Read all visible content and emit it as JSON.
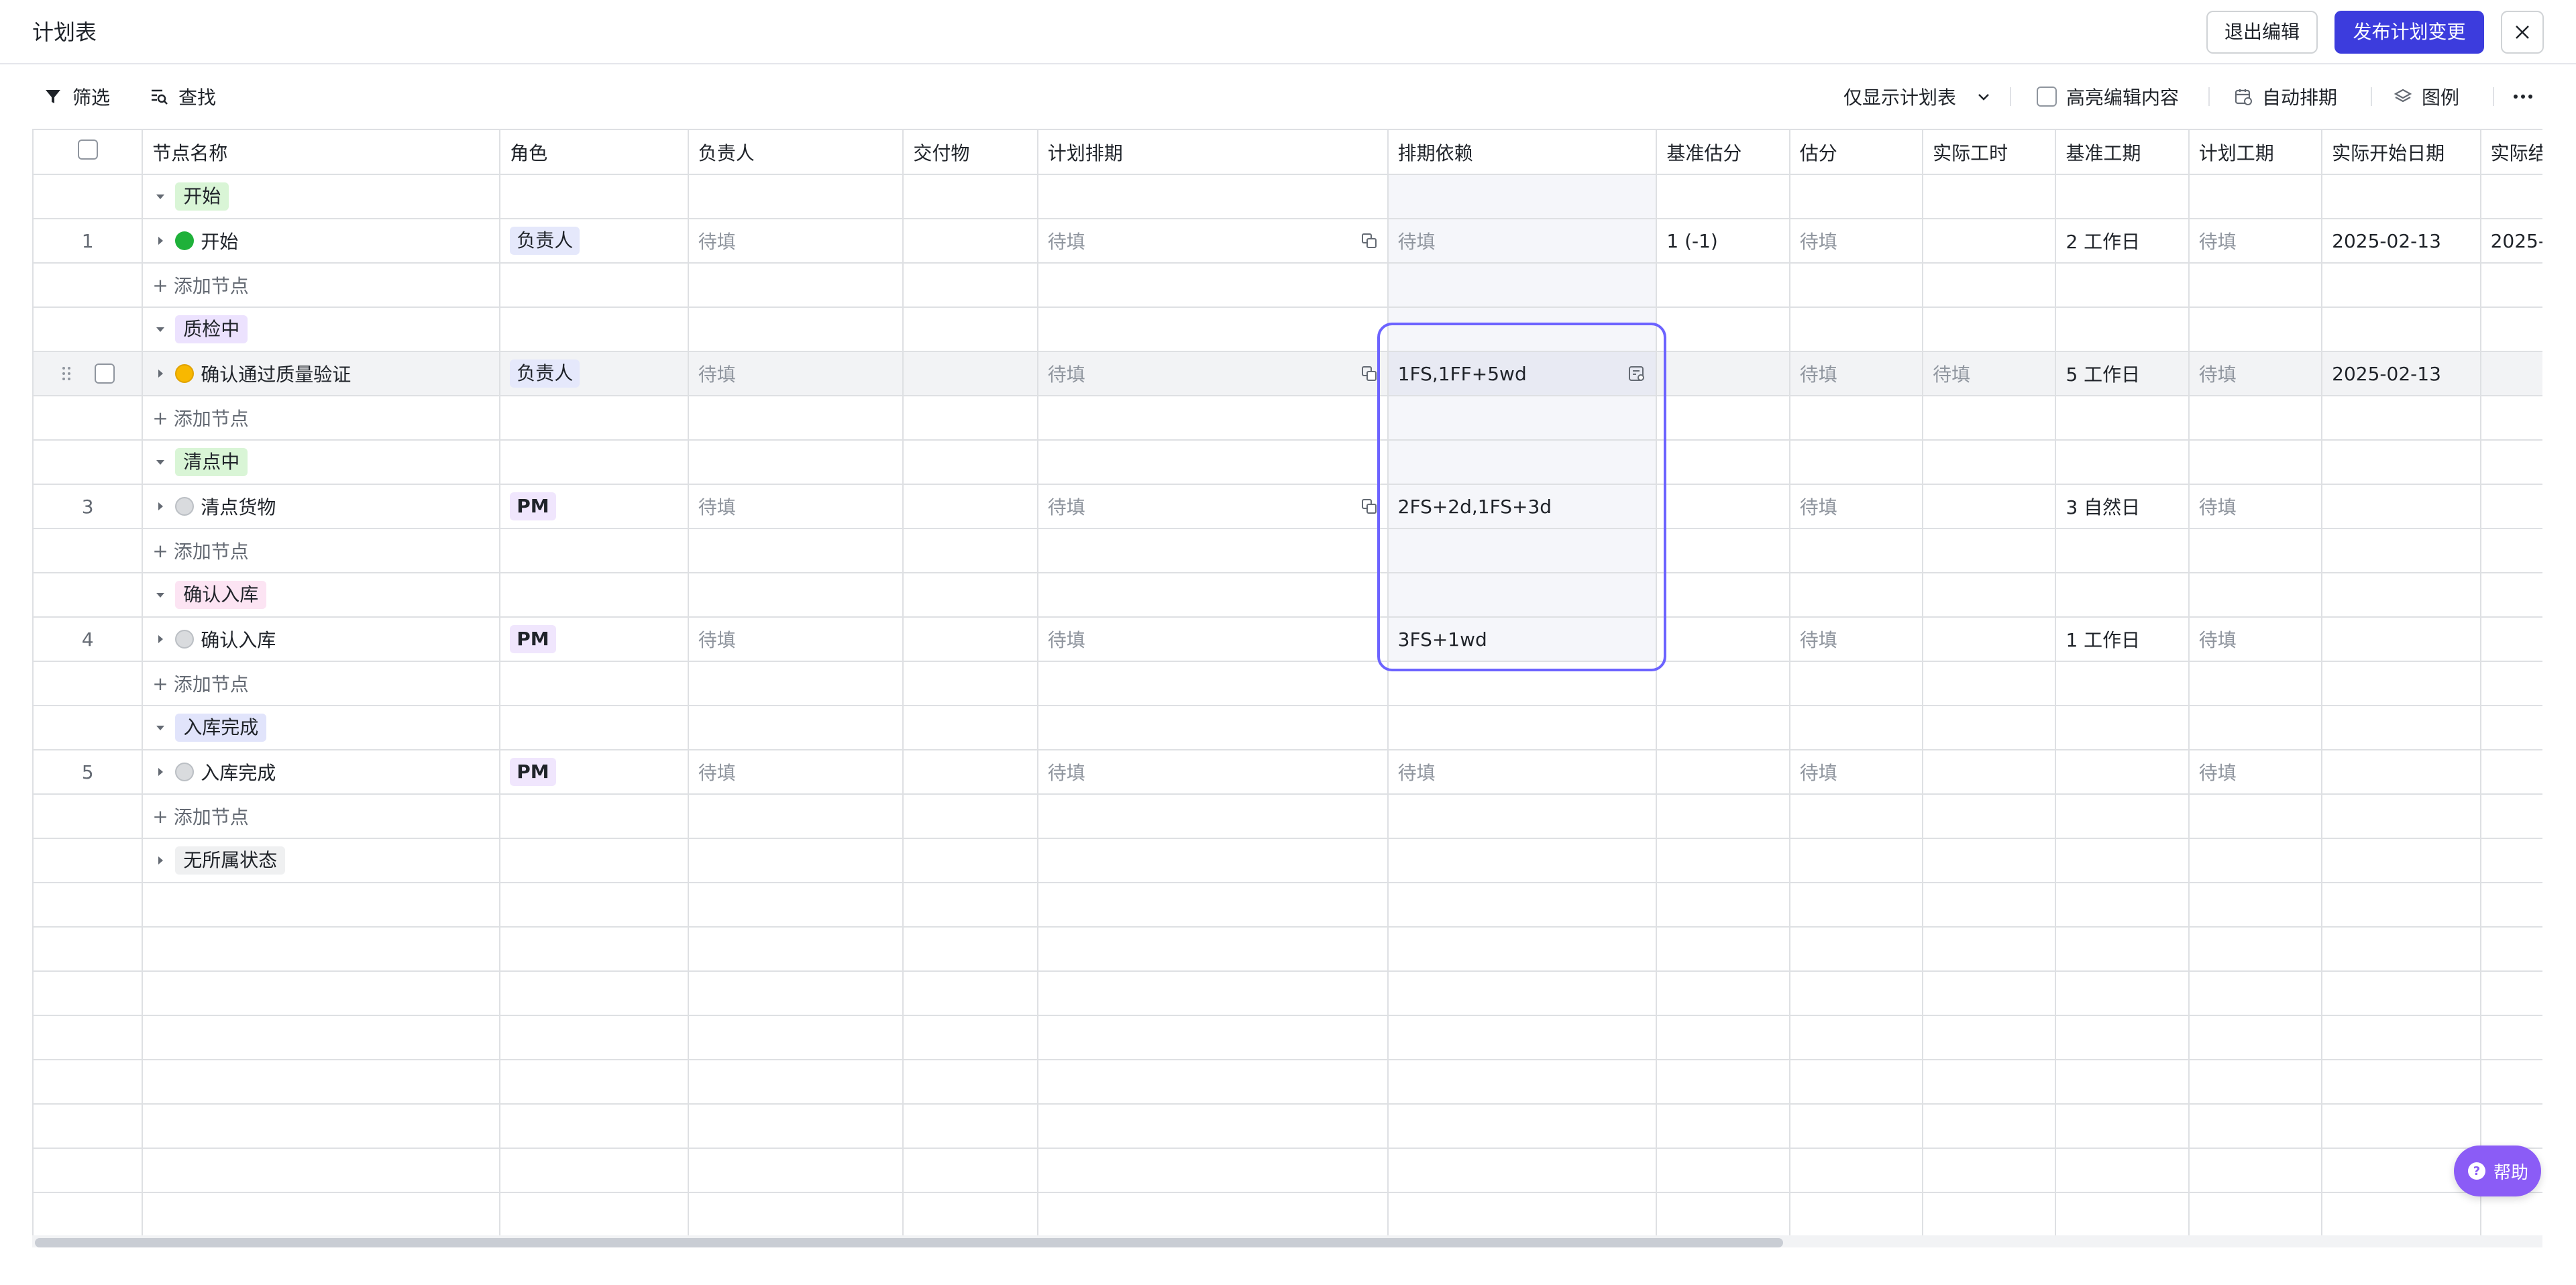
{
  "header": {
    "title": "计划表",
    "exit_label": "退出编辑",
    "publish_label": "发布计划变更"
  },
  "toolbar": {
    "filter_label": "筛选",
    "find_label": "查找",
    "view_select": "仅显示计划表",
    "highlight_label": "高亮编辑内容",
    "auto_schedule_label": "自动排期",
    "legend_label": "图例"
  },
  "columns": [
    "节点名称",
    "角色",
    "负责人",
    "交付物",
    "计划排期",
    "排期依赖",
    "基准估分",
    "估分",
    "实际工时",
    "基准工期",
    "计划工期",
    "实际开始日期",
    "实际结"
  ],
  "placeholder": "待填",
  "add_node_label": "添加节点",
  "groups": [
    {
      "label": "开始"
    },
    {
      "label": "质检中"
    },
    {
      "label": "清点中"
    },
    {
      "label": "确认入库"
    },
    {
      "label": "入库完成"
    },
    {
      "label": "无所属状态"
    }
  ],
  "nodes": [
    {
      "index": "1",
      "name": "开始",
      "role": "负责人",
      "dependency": "待填",
      "base_estimate": "1 (-1)",
      "base_duration": "2 工作日",
      "actual_start": "2025-02-13",
      "actual_end": "2025-"
    },
    {
      "index": "",
      "name": "确认通过质量验证",
      "role": "负责人",
      "dependency": "1FS,1FF+5wd",
      "actual_hours": "待填",
      "base_duration": "5 工作日",
      "actual_start": "2025-02-13"
    },
    {
      "index": "3",
      "name": "清点货物",
      "role": "PM",
      "dependency": "2FS+2d,1FS+3d",
      "base_duration": "3 自然日"
    },
    {
      "index": "4",
      "name": "确认入库",
      "role": "PM",
      "dependency": "3FS+1wd",
      "base_duration": "1 工作日"
    },
    {
      "index": "5",
      "name": "入库完成",
      "role": "PM",
      "dependency": "待填"
    }
  ],
  "help_label": "帮助",
  "colors": {
    "primary": "#3c3cdd",
    "selection": "#6c63ff",
    "help": "#8b5cf6"
  }
}
